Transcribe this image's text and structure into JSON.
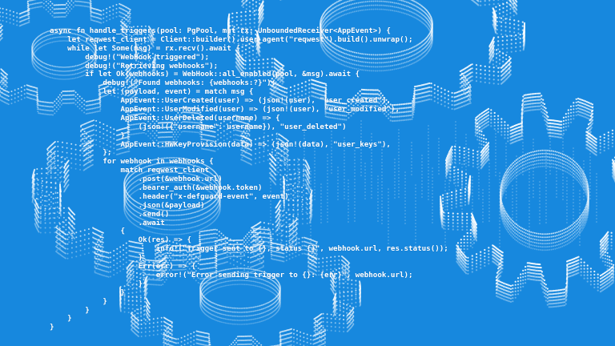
{
  "colors": {
    "background": "#1788de",
    "dots": "#ffffff",
    "code_text": "#ffffff"
  },
  "code_lines": [
    "async fn handle_triggers(pool: PgPool, mut rx: UnboundedReceiver<AppEvent>) {",
    "    let reqwest_client = Client::builder().user_agent(\"reqwest\").build().unwrap();",
    "    while let Some(msg) = rx.recv().await {",
    "        debug!(\"WebHook triggered\");",
    "        debug!(\"Retrieving webhooks\");",
    "        if let Ok(webhooks) = WebHook::all_enabled(pool, &msg).await {",
    "            debug!(\"Found webhooks: {webhooks:?}\");",
    "            let (payload, event) = match msg {",
    "                AppEvent::UserCreated(user) => (json!(user), \"user_created\"),",
    "                AppEvent::UserModified(user) => (json!(user), \"user_modified\"),",
    "                AppEvent::UserDeleted(username) => {",
    "                    (json!({\"username\": username}), \"user_deleted\")",
    "                }",
    "                AppEvent::HWKeyProvision(data) => (json!(data), \"user_keys\"),",
    "            };",
    "            for webhook in webhooks {",
    "                match reqwest_client",
    "                    .post(&webhook.url)",
    "                    .bearer_auth(&webhook.token)",
    "                    .header(\"x-defguard-event\", event)",
    "                    .json(&payload)",
    "                    .send()",
    "                    .await",
    "                {",
    "                    Ok(res) => {",
    "                        info!(\"Trigger sent to {}, status {}\", webhook.url, res.status());",
    "                    }",
    "                    Err(err) => {",
    "                        error!(\"Error sending trigger to {}: {err}\", webhook.url);",
    "                    }",
    "                }",
    "            }",
    "        }",
    "    }",
    "}"
  ]
}
